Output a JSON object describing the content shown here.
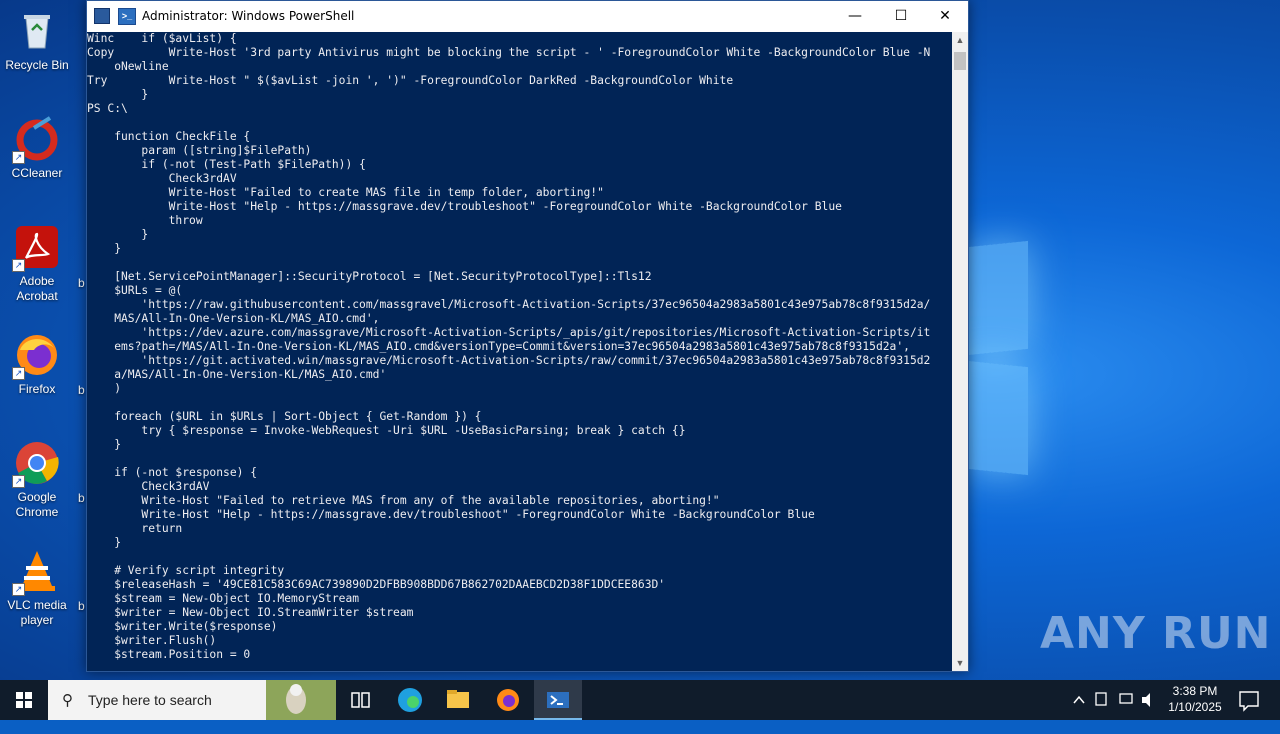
{
  "desktop": {
    "icons": [
      {
        "label": "Recycle Bin",
        "icon": "recycle-bin-icon"
      },
      {
        "label": "CCleaner",
        "icon": "ccleaner-icon"
      },
      {
        "label": "Adobe Acrobat",
        "icon": "adobe-acrobat-icon"
      },
      {
        "label": "Firefox",
        "icon": "firefox-icon"
      },
      {
        "label": "Google Chrome",
        "icon": "chrome-icon"
      },
      {
        "label": "VLC media player",
        "icon": "vlc-icon"
      }
    ],
    "cutoff_labels": [
      "b",
      "b",
      "b",
      "b"
    ],
    "watermark": "ANY RUN"
  },
  "window": {
    "title": "Administrator: Windows PowerShell",
    "minimize": "—",
    "maximize": "☐",
    "close": "✕",
    "bg_color": "#012456",
    "lines": [
      "Winc    if ($avList) {",
      "Copy        Write-Host '3rd party Antivirus might be blocking the script - ' -ForegroundColor White -BackgroundColor Blue -N",
      "    oNewline",
      "Try         Write-Host \" $($avList -join ', ')\" -ForegroundColor DarkRed -BackgroundColor White",
      "        }",
      "PS C:\\",
      "",
      "    function CheckFile {",
      "        param ([string]$FilePath)",
      "        if (-not (Test-Path $FilePath)) {",
      "            Check3rdAV",
      "            Write-Host \"Failed to create MAS file in temp folder, aborting!\"",
      "            Write-Host \"Help - https://massgrave.dev/troubleshoot\" -ForegroundColor White -BackgroundColor Blue",
      "            throw",
      "        }",
      "    }",
      "",
      "    [Net.ServicePointManager]::SecurityProtocol = [Net.SecurityProtocolType]::Tls12",
      "    $URLs = @(",
      "        'https://raw.githubusercontent.com/massgravel/Microsoft-Activation-Scripts/37ec96504a2983a5801c43e975ab78c8f9315d2a/",
      "    MAS/All-In-One-Version-KL/MAS_AIO.cmd',",
      "        'https://dev.azure.com/massgrave/Microsoft-Activation-Scripts/_apis/git/repositories/Microsoft-Activation-Scripts/it",
      "    ems?path=/MAS/All-In-One-Version-KL/MAS_AIO.cmd&versionType=Commit&version=37ec96504a2983a5801c43e975ab78c8f9315d2a',",
      "        'https://git.activated.win/massgrave/Microsoft-Activation-Scripts/raw/commit/37ec96504a2983a5801c43e975ab78c8f9315d2",
      "    a/MAS/All-In-One-Version-KL/MAS_AIO.cmd'",
      "    )",
      "",
      "    foreach ($URL in $URLs | Sort-Object { Get-Random }) {",
      "        try { $response = Invoke-WebRequest -Uri $URL -UseBasicParsing; break } catch {}",
      "    }",
      "",
      "    if (-not $response) {",
      "        Check3rdAV",
      "        Write-Host \"Failed to retrieve MAS from any of the available repositories, aborting!\"",
      "        Write-Host \"Help - https://massgrave.dev/troubleshoot\" -ForegroundColor White -BackgroundColor Blue",
      "        return",
      "    }",
      "",
      "    # Verify script integrity",
      "    $releaseHash = '49CE81C583C69AC739890D2DFBB908BDD67B862702DAAEBCD2D38F1DDCEE863D'",
      "    $stream = New-Object IO.MemoryStream",
      "    $writer = New-Object IO.StreamWriter $stream",
      "    $writer.Write($response)",
      "    $writer.Flush()",
      "    $stream.Position = 0"
    ]
  },
  "taskbar": {
    "search_placeholder": "Type here to search",
    "time": "3:38 PM",
    "date": "1/10/2025",
    "pinned": [
      "task-view-icon",
      "edge-icon",
      "file-explorer-icon",
      "firefox-icon",
      "powershell-icon"
    ]
  }
}
